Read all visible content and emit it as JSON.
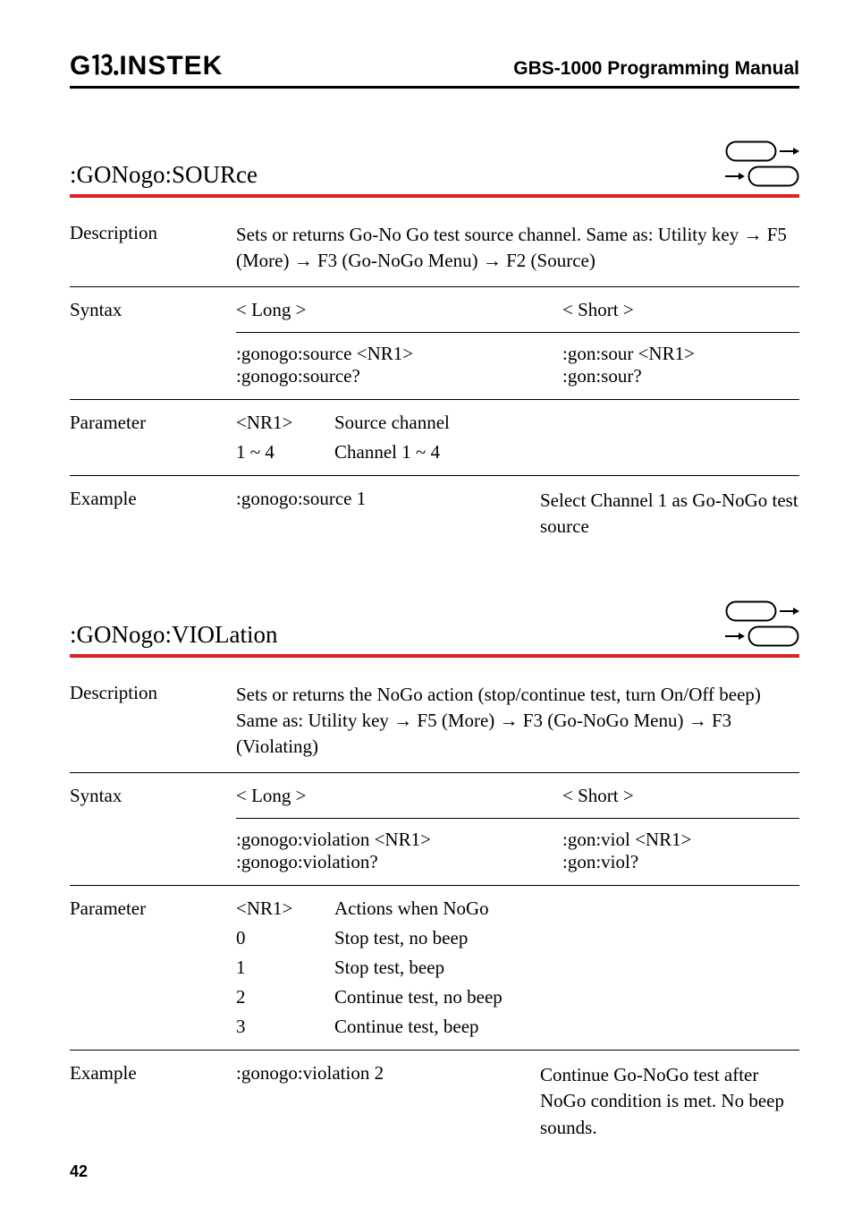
{
  "header": {
    "brand": "G⒔INSTEK",
    "manual": "GBS-1000 Programming Manual"
  },
  "sections": [
    {
      "title": ":GONogo:SOURce",
      "description": "Sets or returns Go-No Go test source channel. Same as: Utility key → F5 (More) → F3 (Go-NoGo Menu) → F2 (Source)",
      "syntax": {
        "long_label": "< Long >",
        "short_label": "< Short >",
        "long_cmds": ":gonogo:source <NR1>\n:gonogo:source?",
        "short_cmds": ":gon:sour <NR1>\n:gon:sour?"
      },
      "parameters": [
        {
          "key": "<NR1>",
          "val": "Source channel"
        },
        {
          "key": "1 ~ 4",
          "val": "Channel 1 ~ 4"
        }
      ],
      "example": {
        "cmd": ":gonogo:source 1",
        "desc": "Select Channel 1 as Go-NoGo test source"
      }
    },
    {
      "title": ":GONogo:VIOLation",
      "description": "Sets or returns the NoGo action (stop/continue test, turn On/Off beep)\nSame as: Utility key → F5 (More) → F3 (Go-NoGo Menu) → F3 (Violating)",
      "syntax": {
        "long_label": "< Long >",
        "short_label": "< Short >",
        "long_cmds": ":gonogo:violation <NR1>\n:gonogo:violation?",
        "short_cmds": ":gon:viol <NR1>\n:gon:viol?"
      },
      "parameters": [
        {
          "key": "<NR1>",
          "val": "Actions when NoGo"
        },
        {
          "key": "0",
          "val": "Stop test, no beep"
        },
        {
          "key": "1",
          "val": "Stop test, beep"
        },
        {
          "key": "2",
          "val": "Continue test, no beep"
        },
        {
          "key": "3",
          "val": "Continue test, beep"
        }
      ],
      "example": {
        "cmd": ":gonogo:violation 2",
        "desc": "Continue Go-NoGo test after NoGo condition is met. No beep sounds."
      }
    }
  ],
  "labels": {
    "description": "Description",
    "syntax": "Syntax",
    "parameter": "Parameter",
    "example": "Example"
  },
  "page": "42"
}
